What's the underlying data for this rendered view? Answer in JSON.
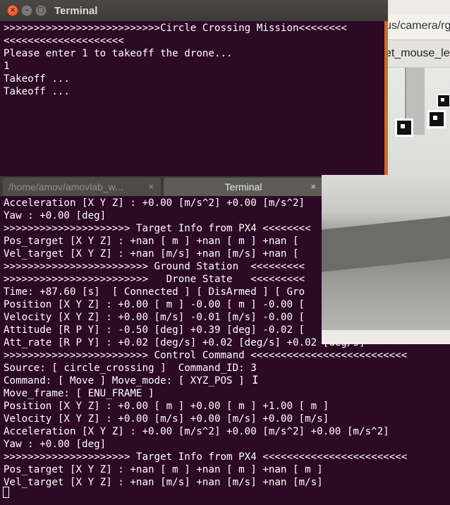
{
  "front_terminal": {
    "title": "Terminal",
    "window_buttons": {
      "close": "×",
      "minimize": "–",
      "maximize": "□"
    },
    "lines": [
      ">>>>>>>>>>>>>>>>>>>>>>>>>>Circle Crossing Mission<<<<<<<<",
      "<<<<<<<<<<<<<<<<<<<<",
      "Please enter 1 to takeoff the drone...",
      "1",
      "Takeoff ...",
      "Takeoff ..."
    ]
  },
  "camera_window": {
    "title_fragment": "us/camera/rgb",
    "button_fragment": "et_mouse_left"
  },
  "bottom_terminal": {
    "tabs": [
      {
        "label": "/home/amov/amovlab_w...",
        "close": "×"
      },
      {
        "label": "Terminal",
        "close": "×"
      }
    ],
    "lines": [
      "Acceleration [X Y Z] : +0.00 [m/s^2] +0.00 [m/s^2]",
      "Yaw : +0.00 [deg]",
      ">>>>>>>>>>>>>>>>>>>>> Target Info from PX4 <<<<<<<<",
      "Pos_target [X Y Z] : +nan [ m ] +nan [ m ] +nan [",
      "Vel_target [X Y Z] : +nan [m/s] +nan [m/s] +nan [",
      ">>>>>>>>>>>>>>>>>>>>>>>> Ground Station  <<<<<<<<<",
      ">>>>>>>>>>>>>>>>>>>>>>>>   Drone State   <<<<<<<<<",
      "Time: +87.60 [s]  [ Connected ] [ DisArmed ] [ Gro",
      "Position [X Y Z] : +0.00 [ m ] -0.00 [ m ] -0.00 [",
      "Velocity [X Y Z] : +0.00 [m/s] -0.01 [m/s] -0.00 [",
      "Attitude [R P Y] : -0.50 [deg] +0.39 [deg] -0.02 [",
      "Att_rate [R P Y] : +0.02 [deg/s] +0.02 [deg/s] +0.02 [deg/s]",
      ">>>>>>>>>>>>>>>>>>>>>>>> Control Command <<<<<<<<<<<<<<<<<<<<<<<<<<",
      "Source: [ circle_crossing ]  Command_ID: 3",
      "Command: [ Move ] Move_mode: [ XYZ_POS ]",
      "Move_frame: [ ENU_FRAME ]",
      "Position [X Y Z] : +0.00 [ m ] +0.00 [ m ] +1.00 [ m ]",
      "Velocity [X Y Z] : +0.00 [m/s] +0.00 [m/s] +0.00 [m/s]",
      "Acceleration [X Y Z] : +0.00 [m/s^2] +0.00 [m/s^2] +0.00 [m/s^2]",
      "Yaw : +0.00 [deg]",
      ">>>>>>>>>>>>>>>>>>>>> Target Info from PX4 <<<<<<<<<<<<<<<<<<<<<<<<",
      "Pos_target [X Y Z] : +nan [ m ] +nan [ m ] +nan [ m ]",
      "Vel_target [X Y Z] : +nan [m/s] +nan [m/s] +nan [m/s]"
    ]
  },
  "colors": {
    "terminal_bg": "#2c0925",
    "terminal_text": "#ffffff",
    "titlebar_bg": "#3c3b37",
    "accent_orange": "#d9662e",
    "close_button": "#df4a16"
  },
  "icons": {
    "cursor": "block-cursor-icon",
    "text_ibeam": "ibeam-cursor-icon"
  }
}
